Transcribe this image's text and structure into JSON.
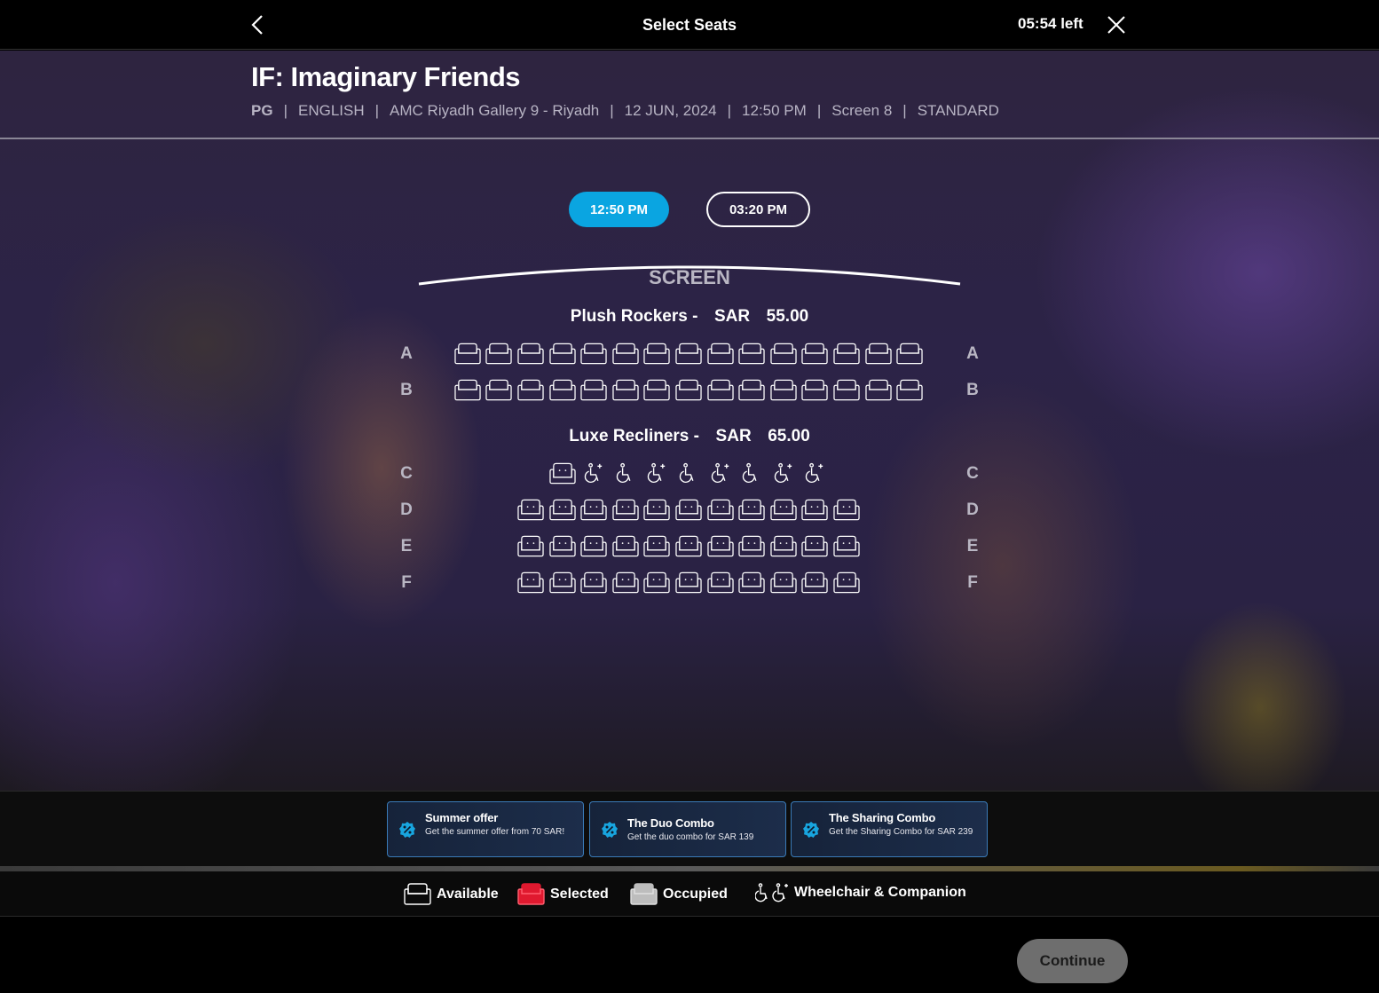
{
  "header": {
    "title": "Select Seats",
    "timer": "05:54 left"
  },
  "movie": {
    "title": "IF: Imaginary Friends",
    "rating": "PG",
    "language": "ENGLISH",
    "cinema": "AMC Riyadh Gallery 9 - Riyadh",
    "date": "12 JUN, 2024",
    "time": "12:50 PM",
    "screen": "Screen 8",
    "experience": "STANDARD",
    "separator": "|"
  },
  "showtimes": [
    {
      "label": "12:50 PM",
      "selected": true
    },
    {
      "label": "03:20 PM",
      "selected": false
    }
  ],
  "screen_label": "SCREEN",
  "tiers": [
    {
      "name": "Plush Rockers -",
      "currency": "SAR",
      "price": "55.00"
    },
    {
      "name": "Luxe Recliners -",
      "currency": "SAR",
      "price": "65.00"
    }
  ],
  "rows": [
    {
      "letter": "A",
      "seats": 15,
      "type": "rocker"
    },
    {
      "letter": "B",
      "seats": 15,
      "type": "rocker"
    },
    {
      "letter": "C",
      "seats": 9,
      "type": "wheelchair"
    },
    {
      "letter": "D",
      "seats": 11,
      "type": "recliner"
    },
    {
      "letter": "E",
      "seats": 11,
      "type": "recliner"
    },
    {
      "letter": "F",
      "seats": 11,
      "type": "recliner"
    }
  ],
  "offers": [
    {
      "title": "Summer offer",
      "description": "Get the summer offer from 70 SAR!"
    },
    {
      "title": "The Duo Combo",
      "description": "Get the duo combo for SAR 139"
    },
    {
      "title": "The Sharing Combo",
      "description": "Get the Sharing Combo for SAR 239"
    }
  ],
  "legend": {
    "available": "Available",
    "selected": "Selected",
    "occupied": "Occupied",
    "wheelchair": "Wheelchair & Companion"
  },
  "colors": {
    "accent": "#0aa5e1",
    "selected_seat": "#e0192f",
    "occupied_seat": "#bdbdbd",
    "offer_border": "#3a7bb8"
  },
  "continue_label": "Continue"
}
